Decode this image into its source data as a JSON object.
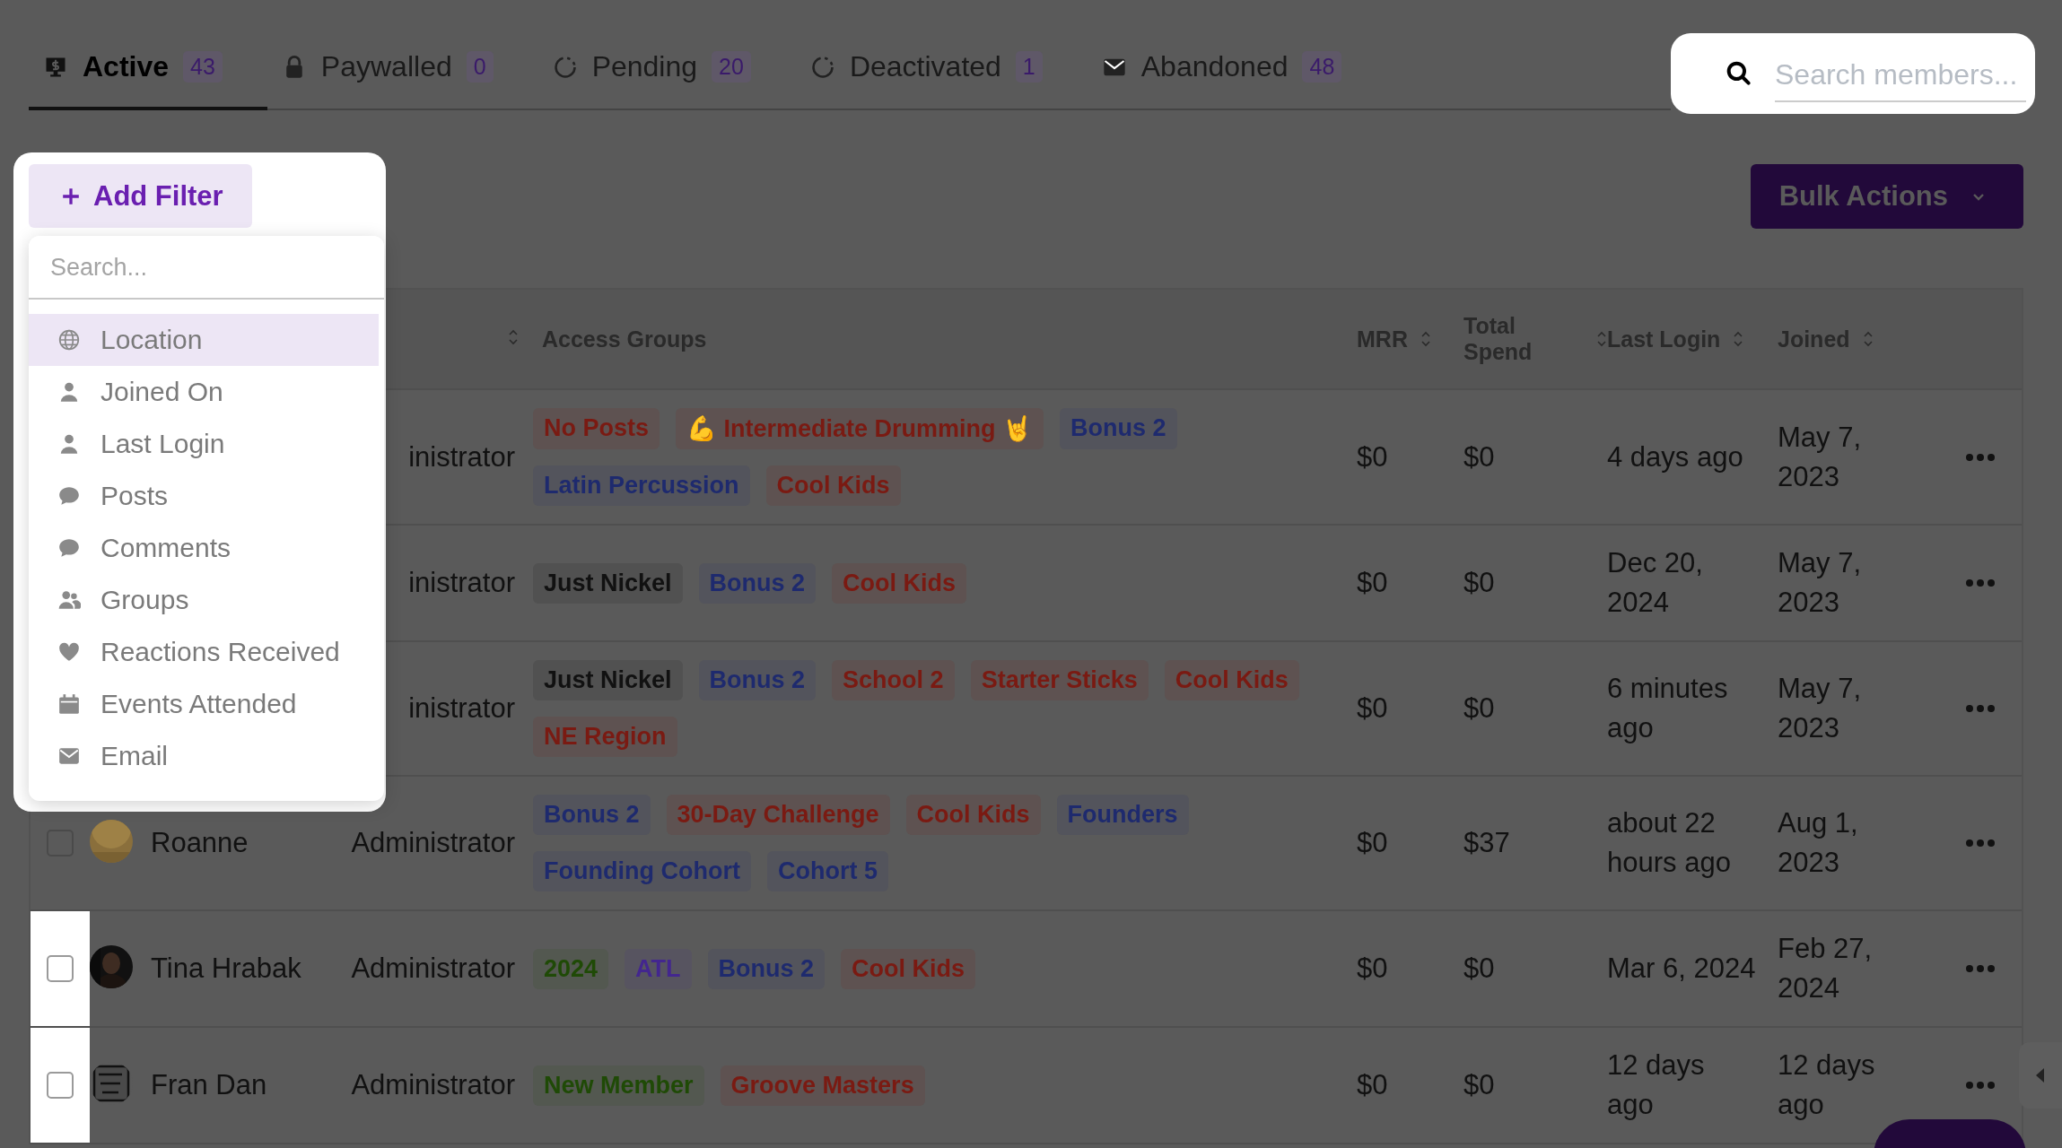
{
  "tabs": [
    {
      "label": "Active",
      "count": "43",
      "selected": true
    },
    {
      "label": "Paywalled",
      "count": "0",
      "selected": false
    },
    {
      "label": "Pending",
      "count": "20",
      "selected": false
    },
    {
      "label": "Deactivated",
      "count": "1",
      "selected": false
    },
    {
      "label": "Abandoned",
      "count": "48",
      "selected": false
    }
  ],
  "search": {
    "placeholder": "Search members..."
  },
  "filter": {
    "button": "Add Filter",
    "search_placeholder": "Search...",
    "items": [
      {
        "label": "Location",
        "selected": true
      },
      {
        "label": "Joined On",
        "selected": false
      },
      {
        "label": "Last Login",
        "selected": false
      },
      {
        "label": "Posts",
        "selected": false
      },
      {
        "label": "Comments",
        "selected": false
      },
      {
        "label": "Groups",
        "selected": false
      },
      {
        "label": "Reactions Received",
        "selected": false
      },
      {
        "label": "Events Attended",
        "selected": false
      },
      {
        "label": "Email",
        "selected": false
      }
    ]
  },
  "bulk_actions": "Bulk Actions",
  "table": {
    "columns": [
      "Access Groups",
      "MRR",
      "Total Spend",
      "Last Login",
      "Joined"
    ],
    "rows": [
      {
        "role": "inistrator",
        "groups": [
          {
            "label": "No Posts",
            "color": "#7a1a12"
          },
          {
            "label": "💪 Intermediate Drumming 🤘",
            "color": "#7a1a12"
          },
          {
            "label": "Bonus 2",
            "color": "#1e2a6e"
          },
          {
            "label": "Latin Percussion",
            "color": "#1e2a6e"
          },
          {
            "label": "Cool Kids",
            "color": "#7a1a12"
          }
        ],
        "mrr": "$0",
        "spend": "$0",
        "last_login": "4 days ago",
        "joined": "May 7, 2023"
      },
      {
        "role": "inistrator",
        "groups": [
          {
            "label": "Just Nickel",
            "color": "#111111"
          },
          {
            "label": "Bonus 2",
            "color": "#1e2a6e"
          },
          {
            "label": "Cool Kids",
            "color": "#7a1a12"
          }
        ],
        "mrr": "$0",
        "spend": "$0",
        "last_login": "Dec 20, 2024",
        "joined": "May 7, 2023"
      },
      {
        "role": "inistrator",
        "groups": [
          {
            "label": "Just Nickel",
            "color": "#111111"
          },
          {
            "label": "Bonus 2",
            "color": "#1e2a6e"
          },
          {
            "label": "School 2",
            "color": "#7a1a12"
          },
          {
            "label": "Starter Sticks",
            "color": "#7a1a12"
          },
          {
            "label": "Cool Kids",
            "color": "#7a1a12"
          },
          {
            "label": "NE Region",
            "color": "#7a1a12"
          }
        ],
        "mrr": "$0",
        "spend": "$0",
        "last_login": "6 minutes ago",
        "joined": "May 7, 2023"
      },
      {
        "checked": false,
        "spotlight": false,
        "avatar": {
          "kind": "picture"
        },
        "name": "Roanne",
        "role": "Administrator",
        "groups": [
          {
            "label": "Bonus 2",
            "color": "#1e2a6e"
          },
          {
            "label": "30-Day Challenge",
            "color": "#7a1a12"
          },
          {
            "label": "Cool Kids",
            "color": "#7a1a12"
          },
          {
            "label": "Founders",
            "color": "#1e2a6e"
          },
          {
            "label": "Founding Cohort",
            "color": "#1e2a6e"
          },
          {
            "label": "Cohort 5",
            "color": "#1e2a6e"
          }
        ],
        "mrr": "$0",
        "spend": "$37",
        "last_login": "about 22 hours ago",
        "joined": "Aug 1, 2023"
      },
      {
        "checked": false,
        "spotlight": true,
        "avatar": {
          "kind": "picture"
        },
        "name": "Tina Hrabak",
        "role": "Administrator",
        "groups": [
          {
            "label": "2024",
            "color": "#1f4a06"
          },
          {
            "label": "ATL",
            "color": "#43268f"
          },
          {
            "label": "Bonus 2",
            "color": "#1e2a6e"
          },
          {
            "label": "Cool Kids",
            "color": "#7a1a12"
          }
        ],
        "mrr": "$0",
        "spend": "$0",
        "last_login": "Mar 6, 2024",
        "joined": "Feb 27, 2024"
      },
      {
        "checked": false,
        "spotlight": true,
        "avatar": {
          "kind": "picture"
        },
        "name": "Fran Dan",
        "role": "Administrator",
        "groups": [
          {
            "label": "New Member",
            "color": "#1f4a06"
          },
          {
            "label": "Groove Masters",
            "color": "#7a1a12"
          }
        ],
        "mrr": "$0",
        "spend": "$0",
        "last_login": "12 days ago",
        "joined": "12 days ago"
      }
    ]
  }
}
